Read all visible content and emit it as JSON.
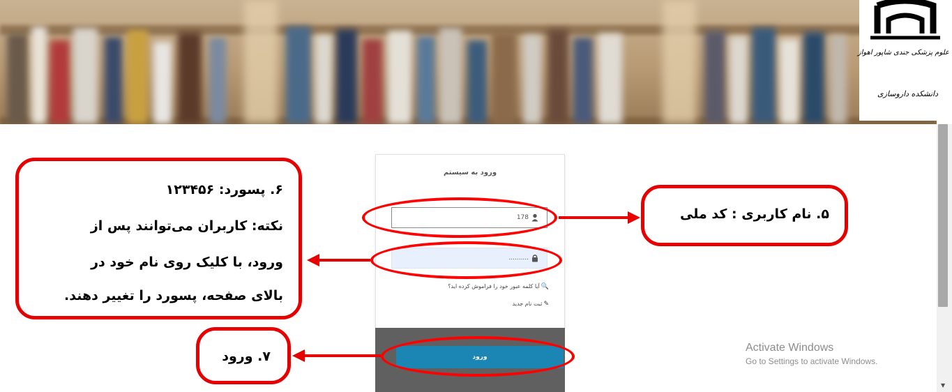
{
  "logo": {
    "line1": "علوم پزشکی جندی شاپور اهواز",
    "line2": "دانشکده داروسازی"
  },
  "login_card": {
    "title": "ورود به سیستم",
    "username_value": "178",
    "password_value": "..........",
    "forgot_link": "آیا کلمه عبور خود را فراموش کرده اید؟",
    "signup_link": "ثبت نام جدید",
    "login_button": "ورود"
  },
  "annotations": {
    "username_note": "۵. نام کاربری : کد ملی",
    "password_note_line1": "۶. پسورد: ۱۲۳۴۵۶",
    "password_note_line2": "نکته: کاربران می‌توانند پس از",
    "password_note_line3": "ورود، با کلیک روی نام خود در",
    "password_note_line4": "بالای صفحه، پسورد را تغییر دهند.",
    "login_note": "۷. ورود"
  },
  "watermark": {
    "title": "Activate Windows",
    "subtitle": "Go to Settings to activate Windows."
  },
  "colors": {
    "annotation_red": "#e60000",
    "login_button": "#1b86b4",
    "card_footer": "#606060"
  }
}
